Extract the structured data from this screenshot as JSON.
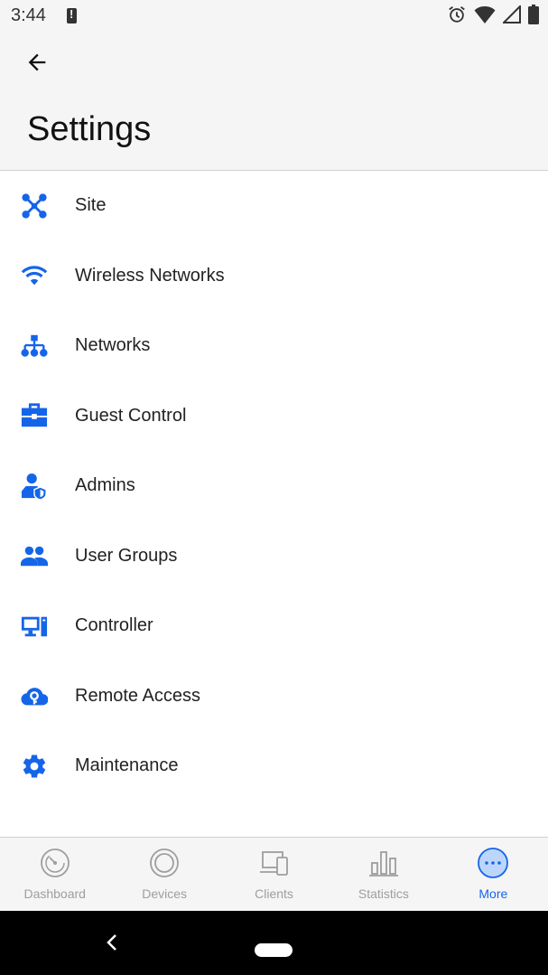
{
  "status_bar": {
    "time": "3:44",
    "icons": [
      "alert-icon",
      "alarm-icon",
      "wifi-icon",
      "signal-icon",
      "battery-icon"
    ]
  },
  "header": {
    "back_icon": "arrow-back-icon",
    "title": "Settings"
  },
  "settings_items": [
    {
      "label": "Site",
      "icon": "site-network-icon"
    },
    {
      "label": "Wireless Networks",
      "icon": "wifi-icon"
    },
    {
      "label": "Networks",
      "icon": "hierarchy-network-icon"
    },
    {
      "label": "Guest Control",
      "icon": "briefcase-icon"
    },
    {
      "label": "Admins",
      "icon": "admin-shield-icon"
    },
    {
      "label": "User Groups",
      "icon": "user-group-icon"
    },
    {
      "label": "Controller",
      "icon": "desktop-computer-icon"
    },
    {
      "label": "Remote Access",
      "icon": "cloud-key-icon"
    },
    {
      "label": "Maintenance",
      "icon": "gear-icon"
    }
  ],
  "bottom_nav": [
    {
      "label": "Dashboard",
      "icon": "dashboard-gauge-icon",
      "active": false
    },
    {
      "label": "Devices",
      "icon": "device-circle-icon",
      "active": false
    },
    {
      "label": "Clients",
      "icon": "clients-devices-icon",
      "active": false
    },
    {
      "label": "Statistics",
      "icon": "bar-chart-icon",
      "active": false
    },
    {
      "label": "More",
      "icon": "more-dots-icon",
      "active": true
    }
  ],
  "colors": {
    "accent": "#1565e8",
    "inactive": "#9e9e9e",
    "bar_background": "#f5f5f5"
  }
}
